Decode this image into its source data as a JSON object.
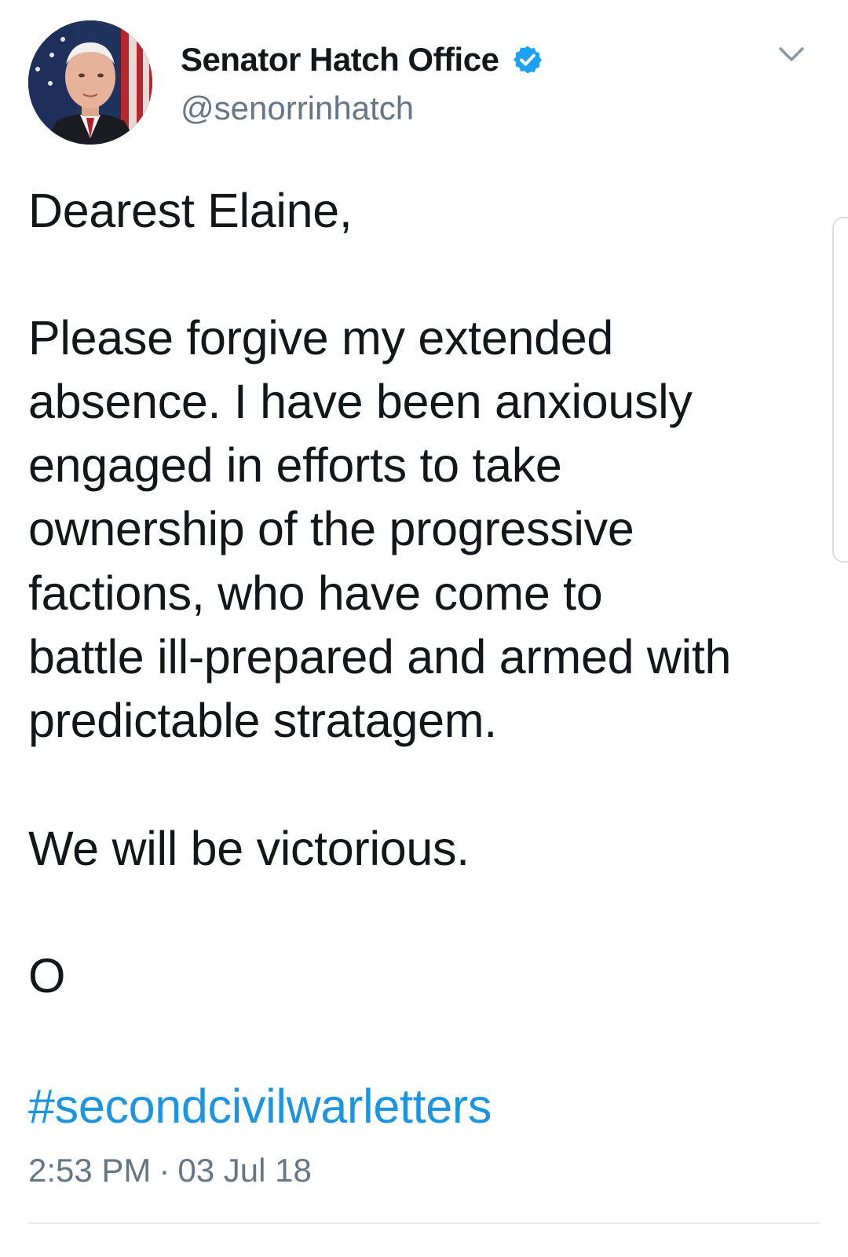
{
  "header": {
    "display_name": "Senator Hatch Office",
    "handle": "@senorrinhatch",
    "verified_icon": "verified-badge-icon",
    "menu_icon": "chevron-down-icon"
  },
  "tweet": {
    "greeting": "Dearest Elaine,",
    "paragraph_lines": [
      "Please forgive my extended",
      "absence. I have been anxiously",
      "engaged in efforts to take",
      "ownership of the progressive",
      "factions, who have come to",
      "battle ill-prepared and armed with",
      "predictable stratagem."
    ],
    "closing": "We will be victorious.",
    "signature": "O",
    "hashtag": "#secondcivilwarletters"
  },
  "meta": {
    "time": "2:53 PM",
    "separator": "·",
    "date": "03 Jul 18"
  },
  "colors": {
    "text": "#14171a",
    "secondary": "#657786",
    "link": "#1b95e0",
    "verified": "#1da1f2"
  }
}
